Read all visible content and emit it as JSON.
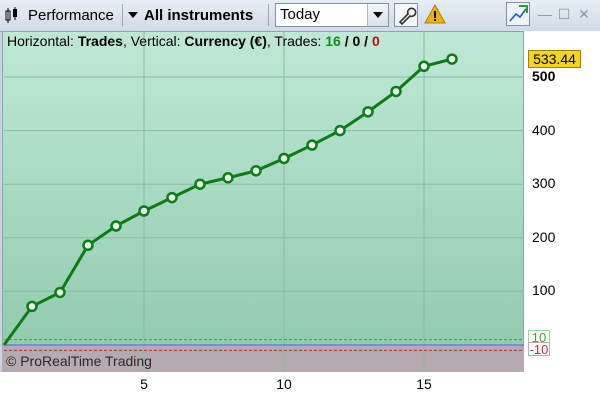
{
  "toolbar": {
    "performance_label": "Performance",
    "instruments_label": "All instruments",
    "period_value": "Today"
  },
  "header": {
    "h_prefix": "Horizontal: ",
    "h_value": "Trades",
    "v_prefix": ", Vertical: ",
    "v_value": "Currency (€)",
    "t_prefix": ", Trades: ",
    "trades_win": "16",
    "slash1": " / ",
    "trades_zero": "0",
    "slash2": " / ",
    "trades_loss": "0"
  },
  "last_value": "533.44",
  "threshold_pos": "10",
  "threshold_neg": "-10",
  "copyright": "© ProRealTime Trading",
  "colors": {
    "line": "#0b7d12",
    "pos_threshold": "#33aa33",
    "neg_threshold": "#b03040"
  },
  "chart_data": {
    "type": "line",
    "x": [
      0,
      1,
      2,
      3,
      4,
      5,
      6,
      7,
      8,
      9,
      10,
      11,
      12,
      13,
      14,
      15,
      16
    ],
    "y": [
      0,
      72,
      98,
      186,
      222,
      250,
      275,
      300,
      312,
      325,
      348,
      373,
      400,
      435,
      473,
      520,
      533.44
    ],
    "xlabel": "Trades",
    "ylabel": "Currency (€)",
    "xticks": [
      "5",
      "10",
      "15"
    ],
    "yticks": [
      "100",
      "200",
      "300",
      "400",
      "500"
    ],
    "xlim": [
      0,
      18.7
    ],
    "ylim": [
      -10,
      560
    ],
    "grid": true
  }
}
